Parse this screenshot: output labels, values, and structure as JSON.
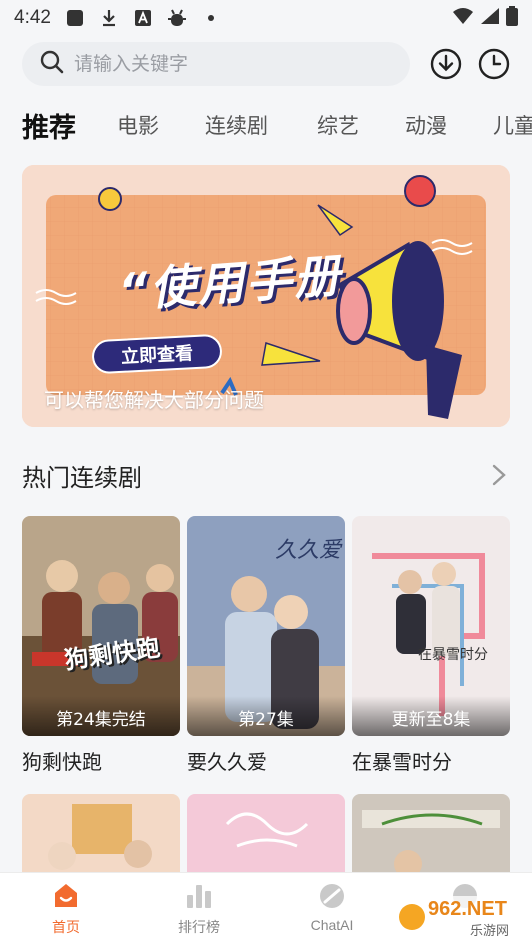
{
  "status_bar": {
    "time": "4:42"
  },
  "search": {
    "placeholder": "请输入关键字"
  },
  "tabs": [
    {
      "label": "推荐",
      "active": true
    },
    {
      "label": "电影"
    },
    {
      "label": "连续剧"
    },
    {
      "label": "综艺"
    },
    {
      "label": "动漫"
    },
    {
      "label": "儿童"
    }
  ],
  "banner": {
    "title": "“使用手册",
    "button": "立即查看",
    "caption": "可以帮您解决大部分问题"
  },
  "section": {
    "title": "热门连续剧"
  },
  "cards": [
    {
      "title": "狗剩快跑",
      "badge": "第24集完结",
      "poster_text": "狗剩快跑"
    },
    {
      "title": "要久久爱",
      "badge": "第27集",
      "poster_text": "久久爱"
    },
    {
      "title": "在暴雪时分",
      "badge": "更新至8集",
      "poster_text": "在暴雪时分"
    }
  ],
  "nav": [
    {
      "label": "首页",
      "icon": "home-icon",
      "active": true
    },
    {
      "label": "排行榜",
      "icon": "ranking-icon"
    },
    {
      "label": "ChatAI",
      "icon": "chat-ai-icon"
    }
  ],
  "watermark": {
    "text": "962.NET",
    "sub": "乐游网"
  },
  "colors": {
    "accent": "#f26b2f",
    "banner_bg": "#f6d8c8"
  }
}
